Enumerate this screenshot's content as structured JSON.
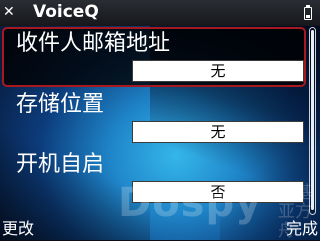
{
  "app": {
    "title": "VoiceQ"
  },
  "settings": [
    {
      "label": "收件人邮箱地址",
      "value": "无"
    },
    {
      "label": "存储位置",
      "value": "无"
    },
    {
      "label": "开机自启",
      "value": "否"
    }
  ],
  "softkeys": {
    "left": "更改",
    "right": "完成"
  },
  "watermark": {
    "brand": "Dospy",
    "cn": "诺基亚方舟"
  },
  "colors": {
    "selection_border": "#a8191f",
    "background_accent": "#1f86c9"
  }
}
